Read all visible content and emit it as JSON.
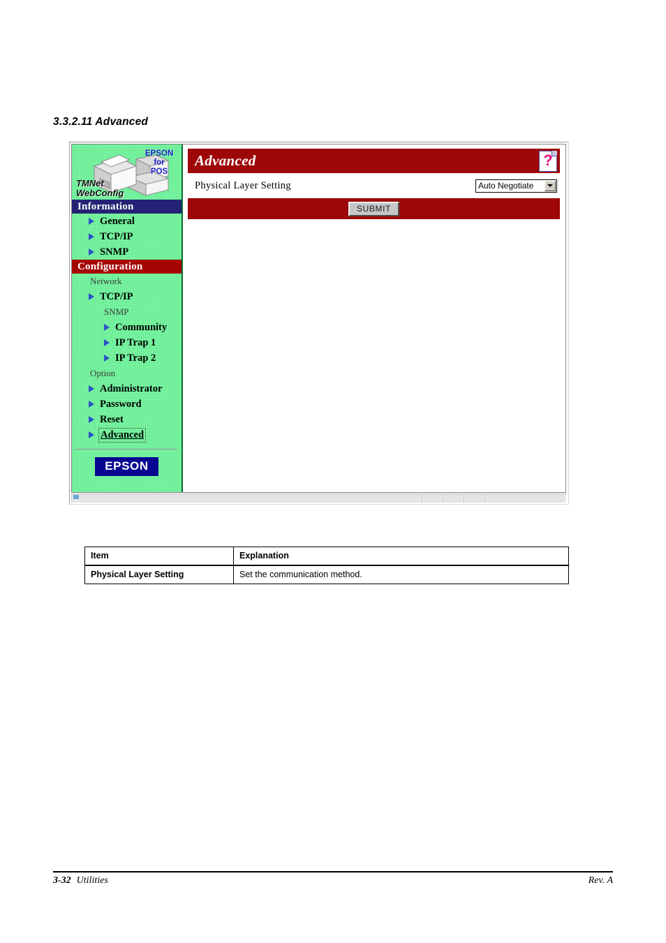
{
  "document": {
    "section_heading": "3.3.2.11 Advanced"
  },
  "browser": {
    "sidebar": {
      "logo": {
        "brand_line1": "EPSON",
        "brand_line2": "for",
        "brand_line3": "POS",
        "product_line1": "TMNet",
        "product_line2": "WebConfig",
        "printer_icon": "printer-icon"
      },
      "sections": [
        {
          "header": "Information",
          "header_color": "#232274",
          "items": [
            {
              "label": "General",
              "bullet": true,
              "level": 1,
              "current": false
            },
            {
              "label": "TCP/IP",
              "bullet": true,
              "level": 1,
              "current": false
            },
            {
              "label": "SNMP",
              "bullet": true,
              "level": 1,
              "current": false
            }
          ]
        },
        {
          "header": "Configuration",
          "header_color": "#a60505",
          "groups": [
            {
              "group_label": "Network",
              "items": [
                {
                  "label": "TCP/IP",
                  "bullet": true,
                  "level": 1,
                  "current": false
                }
              ],
              "subgroups": [
                {
                  "group_label": "SNMP",
                  "items": [
                    {
                      "label": "Community",
                      "bullet": true,
                      "level": 2,
                      "current": false
                    },
                    {
                      "label": "IP Trap 1",
                      "bullet": true,
                      "level": 2,
                      "current": false
                    },
                    {
                      "label": "IP Trap 2",
                      "bullet": true,
                      "level": 2,
                      "current": false
                    }
                  ]
                }
              ]
            },
            {
              "group_label": "Option",
              "items": [
                {
                  "label": "Administrator",
                  "bullet": true,
                  "level": 1,
                  "current": false
                },
                {
                  "label": "Password",
                  "bullet": true,
                  "level": 1,
                  "current": false
                },
                {
                  "label": "Reset",
                  "bullet": true,
                  "level": 1,
                  "current": false
                },
                {
                  "label": "Advanced",
                  "bullet": true,
                  "level": 1,
                  "current": true
                }
              ]
            }
          ]
        }
      ],
      "footer_logo": "EPSON"
    },
    "content": {
      "banner_title": "Advanced",
      "banner_color": "#9e0707",
      "help_icon": "help-question-icon",
      "form": {
        "label": "Physical Layer Setting",
        "select_value": "Auto Negotiate",
        "select_options": [
          "Auto Negotiate"
        ]
      },
      "submit_label": "SUBMIT"
    }
  },
  "explanation_table": {
    "headers": [
      "Item",
      "Explanation"
    ],
    "rows": [
      {
        "item": "Physical Layer Setting",
        "explanation": "Set the communication method."
      }
    ]
  },
  "page_footer": {
    "page_number": "3-32",
    "chapter": "Utilities",
    "revision": "Rev. A"
  }
}
